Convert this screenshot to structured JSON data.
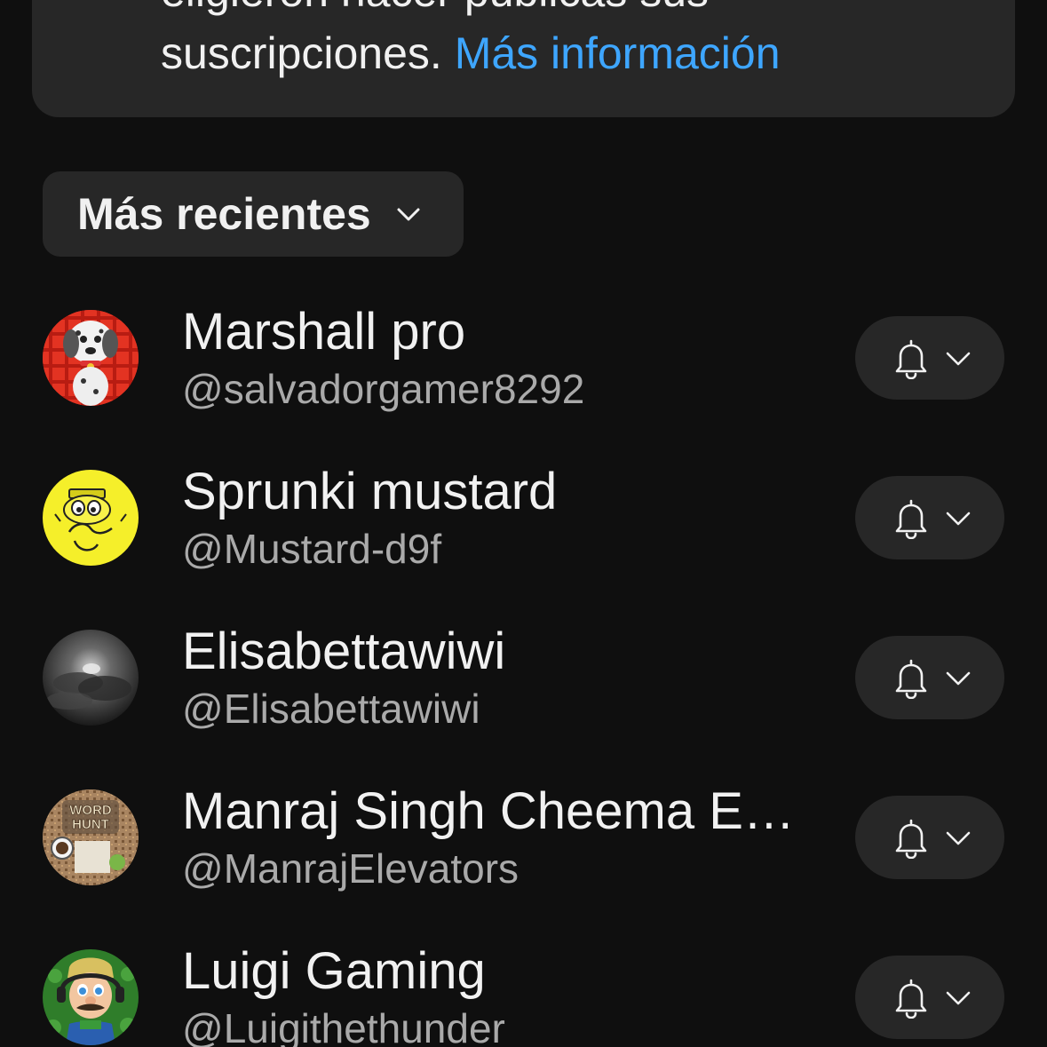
{
  "info_card": {
    "line1": "eligieron hacer públicas sus",
    "line2": "suscripciones.",
    "link": "Más información"
  },
  "sort": {
    "label": "Más recientes"
  },
  "subscriptions": [
    {
      "name": "Marshall pro",
      "handle": "@salvadorgamer8292"
    },
    {
      "name": "Sprunki mustard",
      "handle": "@Mustard-d9f"
    },
    {
      "name": "Elisabettawiwi",
      "handle": "@Elisabettawiwi"
    },
    {
      "name": "Manraj Singh Cheema Elevators",
      "handle": "@ManrajElevators"
    },
    {
      "name": "Luigi Gaming",
      "handle": "@Luigithethunder"
    }
  ],
  "avatar_logo_text": {
    "manraj": "WORD HUNT"
  },
  "colors": {
    "background": "#0f0f0f",
    "surface": "#272727",
    "text_primary": "#f1f1f1",
    "text_secondary": "#aaaaaa",
    "link": "#3ea6ff"
  },
  "icons": {
    "notification": "bell-icon",
    "dropdown": "chevron-down-icon"
  }
}
